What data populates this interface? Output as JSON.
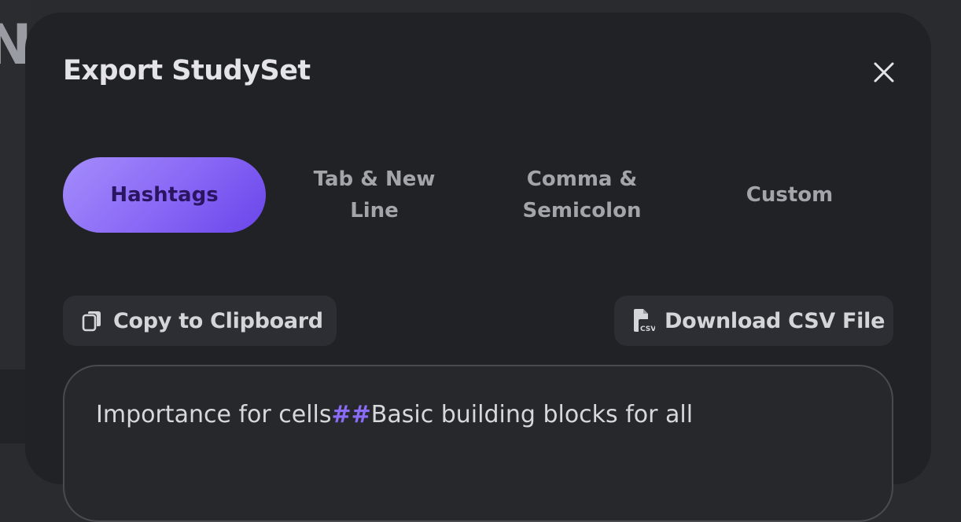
{
  "background": {
    "letter": "N"
  },
  "modal": {
    "title": "Export StudySet",
    "close_icon": "close-icon",
    "tabs": [
      {
        "label": "Hashtags",
        "active": true
      },
      {
        "label": "Tab & New Line",
        "active": false
      },
      {
        "label": "Comma & Semicolon",
        "active": false
      },
      {
        "label": "Custom",
        "active": false
      }
    ],
    "copy_button": {
      "label": "Copy to Clipboard",
      "icon": "copy-icon"
    },
    "download_button": {
      "label": "Download CSV File",
      "icon": "csv-file-icon"
    },
    "preview": {
      "term": "Importance for cells",
      "separator": "##",
      "definition": "Basic building blocks for all"
    },
    "colors": {
      "accent": "#8a6cf6",
      "active_tab_text": "#2a1560",
      "modal_bg": "#212226"
    }
  }
}
